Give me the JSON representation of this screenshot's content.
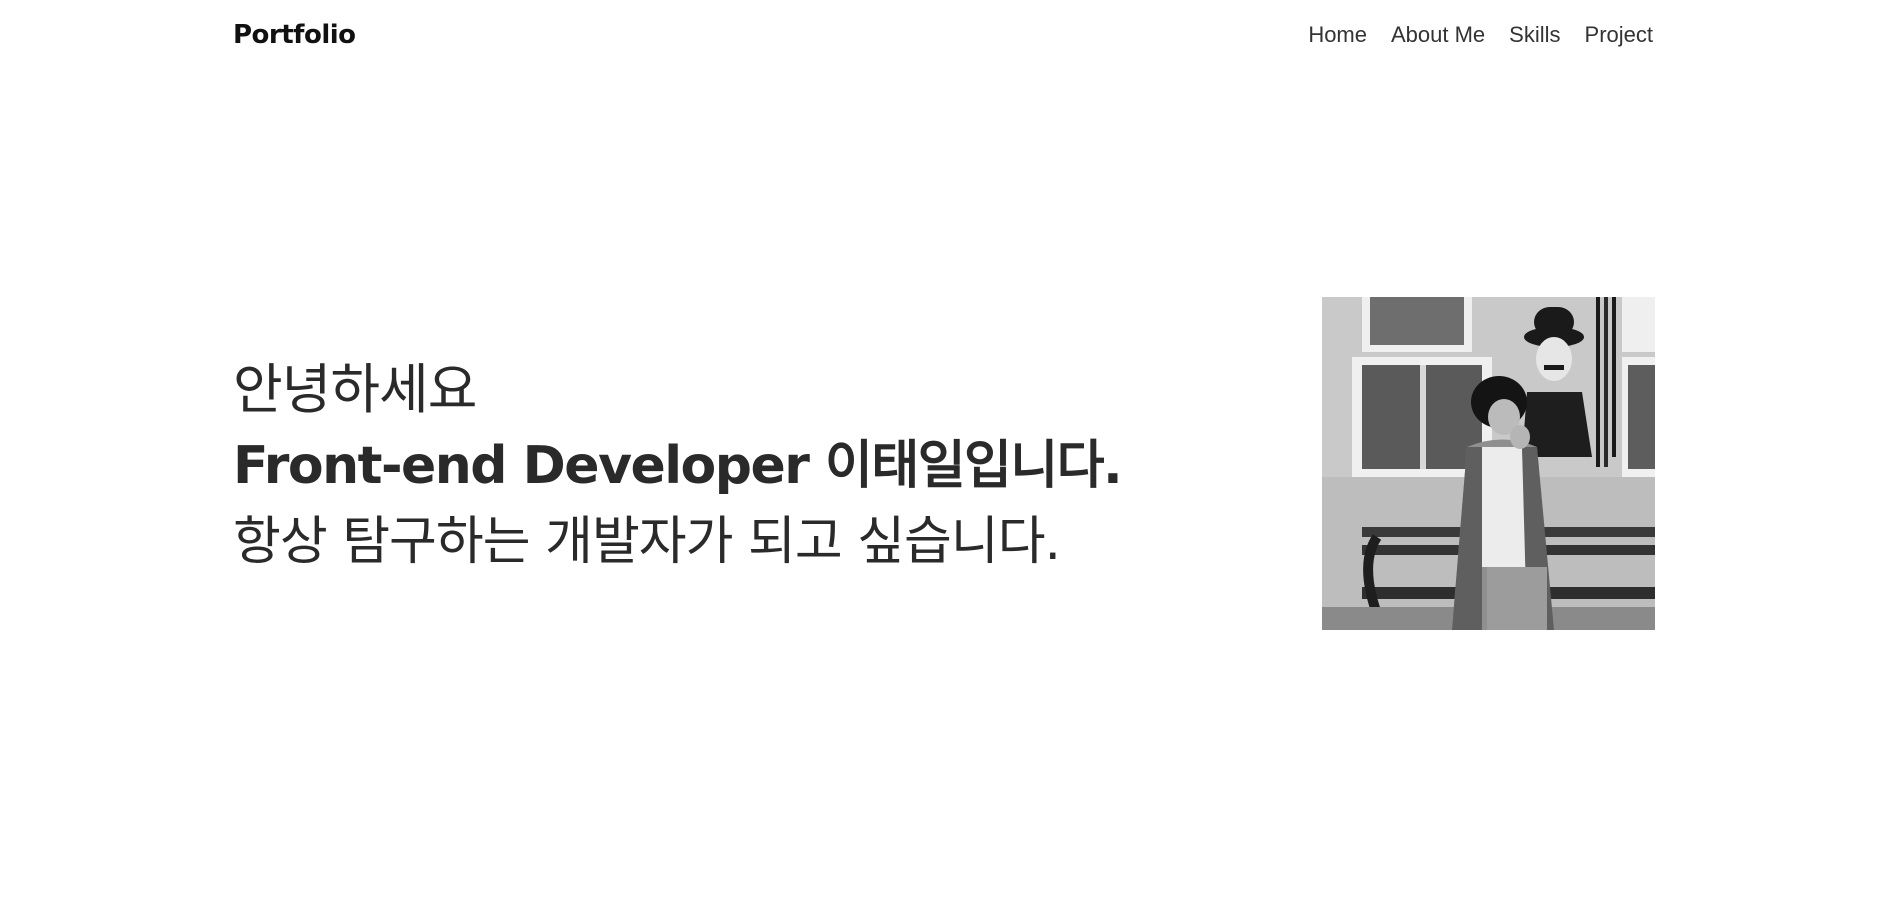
{
  "header": {
    "logo": "Portfolio",
    "nav": [
      {
        "label": "Home"
      },
      {
        "label": "About Me"
      },
      {
        "label": "Skills"
      },
      {
        "label": "Project"
      }
    ]
  },
  "hero": {
    "greeting": "안녕하세요",
    "headline": "Front-end Developer 이태일입니다.",
    "tagline": "항상 탐구하는 개발자가 되고 싶습니다."
  },
  "profile": {
    "image_name": "profile-photo",
    "style": "grayscale"
  }
}
